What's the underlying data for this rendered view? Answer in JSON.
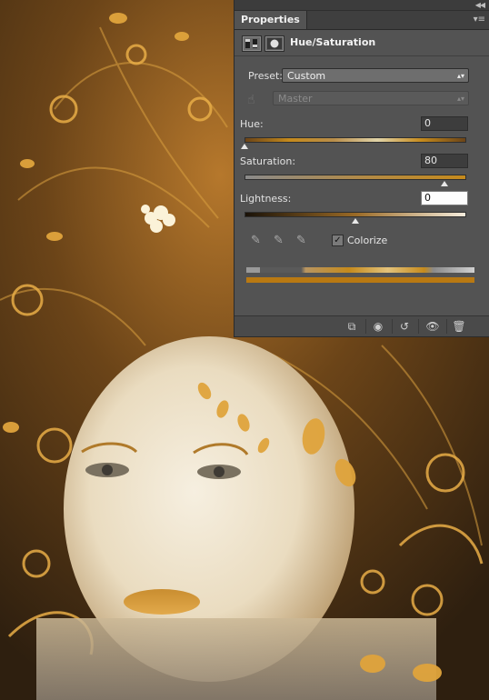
{
  "panel": {
    "tab_label": "Properties",
    "collapse_icon": "double-chevron-left-icon",
    "menu_icon": "panel-menu-icon",
    "title": "Hue/Saturation"
  },
  "preset": {
    "label": "Preset:",
    "value": "Custom"
  },
  "channel": {
    "value": "Master"
  },
  "hue": {
    "label": "Hue:",
    "value": "0",
    "slider_fraction": 0.0
  },
  "saturation": {
    "label": "Saturation:",
    "value": "80",
    "slider_fraction": 0.9
  },
  "lightness": {
    "label": "Lightness:",
    "value": "0",
    "slider_fraction": 0.5
  },
  "colorize": {
    "label": "Colorize",
    "checked": true
  },
  "footer_icons": [
    "clip-to-layer-icon",
    "view-previous-icon",
    "reset-icon",
    "visibility-eye-icon",
    "trash-icon"
  ],
  "colors": {
    "panel_bg": "#535353",
    "accent_gold": "#c58a1c",
    "photo_bg": "#3a2a16"
  }
}
